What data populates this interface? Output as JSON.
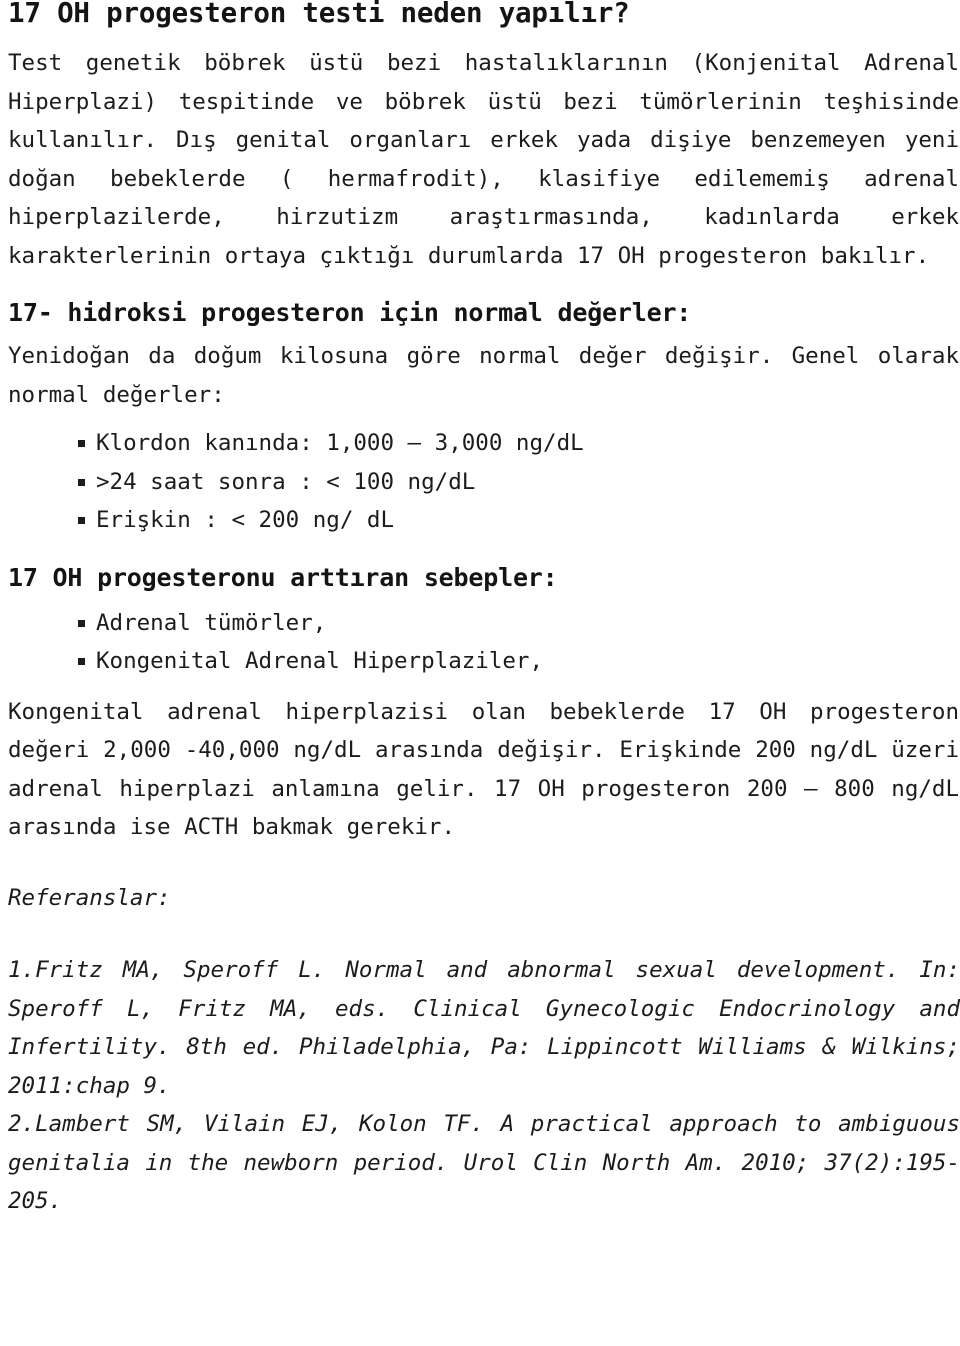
{
  "document": {
    "title": "17 OH progesteron testi neden yapılır?",
    "intro_paragraph": "Test genetik böbrek üstü bezi hastalıklarının (Konjenital Adrenal Hiperplazi) tespitinde ve böbrek üstü bezi tümörlerinin teşhisinde kullanılır. Dış genital organları erkek yada dişiye benzemeyen yeni doğan bebeklerde ( hermafrodit), klasifiye edilememiş adrenal hiperplazilerde, hirzutizm araştırmasında, kadınlarda erkek karakterlerinin ortaya çıktığı durumlarda 17 OH progesteron bakılır.",
    "sections": [
      {
        "heading": "17- hidroksi progesteron için normal değerler:",
        "paragraph": "Yenidoğan da doğum kilosuna göre normal değer değişir. Genel olarak normal değerler:",
        "bullets": [
          "Klordon kanında: 1,000 – 3,000 ng/dL",
          ">24 saat sonra : < 100 ng/dL",
          "Erişkin : < 200 ng/ dL"
        ]
      },
      {
        "heading": "17 OH progesteronu arttıran sebepler:",
        "bullets": [
          "Adrenal tümörler,",
          "Kongenital Adrenal Hiperplaziler,"
        ],
        "paragraph_after": "Kongenital adrenal hiperplazisi olan bebeklerde 17 OH progesteron değeri 2,000 -40,000 ng/dL arasında değişir. Erişkinde 200 ng/dL üzeri adrenal hiperplazi anlamına gelir. 17 OH progesteron 200 – 800 ng/dL arasında ise ACTH bakmak gerekir."
      }
    ],
    "references": {
      "label": "Referanslar:",
      "entries": [
        "1.Fritz MA, Speroff L. Normal and abnormal sexual development. In: Speroff L, Fritz MA, eds. Clinical Gynecologic Endocrinology and Infertility. 8th ed. Philadelphia, Pa: Lippincott Williams & Wilkins; 2011:chap 9.",
        "2.Lambert SM, Vilain EJ, Kolon TF. A practical approach to ambiguous genitalia in the newborn period. Urol Clin North Am. 2010; 37(2):195-205."
      ]
    }
  },
  "colors": {
    "text": "#1c1c1c",
    "heading": "#141414",
    "background": "#ffffff"
  }
}
